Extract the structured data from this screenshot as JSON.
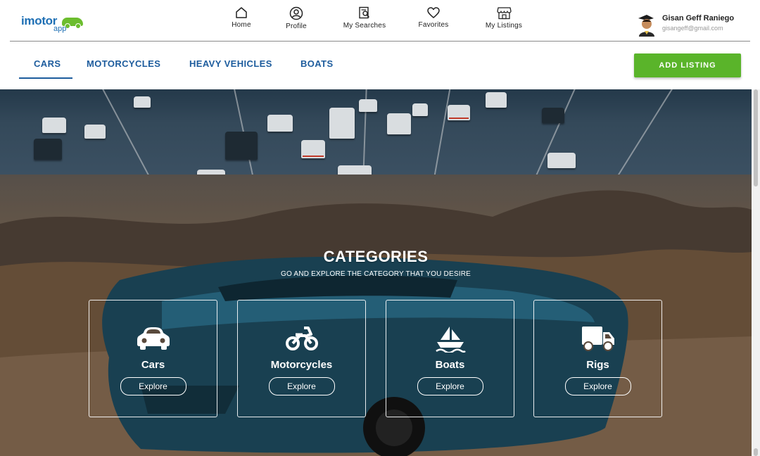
{
  "brand": {
    "name": "imotor",
    "sub": "app",
    "color": "#1e6fb4",
    "accent": "#6cbd2e"
  },
  "topnav": [
    {
      "label": "Home",
      "icon": "home-icon"
    },
    {
      "label": "Profile",
      "icon": "profile-icon"
    },
    {
      "label": "My Searches",
      "icon": "searches-icon"
    },
    {
      "label": "Favorites",
      "icon": "heart-icon"
    },
    {
      "label": "My Listings",
      "icon": "store-icon"
    }
  ],
  "user": {
    "name": "Gisan Geff Raniego",
    "email": "gisangeff@gmail.com"
  },
  "tabs": [
    {
      "label": "CARS",
      "active": true
    },
    {
      "label": "MOTORCYCLES"
    },
    {
      "label": "HEAVY VEHICLES"
    },
    {
      "label": "BOATS"
    }
  ],
  "add_listing": "ADD LISTING",
  "categories": {
    "title": "CATEGORIES",
    "subtitle": "GO AND EXPLORE THE CATEGORY THAT YOU DESIRE",
    "items": [
      {
        "name": "Cars",
        "button": "Explore",
        "icon": "car-icon"
      },
      {
        "name": "Motorcycles",
        "button": "Explore",
        "icon": "motorcycle-icon"
      },
      {
        "name": "Boats",
        "button": "Explore",
        "icon": "boat-icon"
      },
      {
        "name": "Rigs",
        "button": "Explore",
        "icon": "truck-icon"
      }
    ]
  },
  "colors": {
    "tab_text": "#1d5c9d",
    "add_button": "#5ab42a"
  }
}
